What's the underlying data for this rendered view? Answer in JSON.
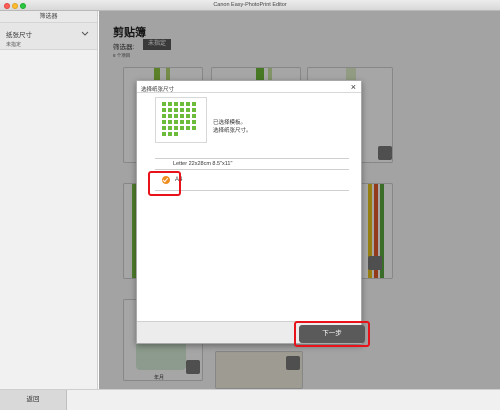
{
  "window": {
    "title": "Canon Easy-PhotoPrint Editor"
  },
  "sidebar": {
    "header": "筛选器",
    "filter": {
      "label": "纸张尺寸",
      "value": "未指定"
    }
  },
  "main": {
    "title": "剪贴簿",
    "filter_label": "筛选器:",
    "filter_badge": "未指定",
    "item_count": "8 个项目",
    "card_captions": [
      "年月"
    ]
  },
  "dialog": {
    "title": "选择纸张尺寸",
    "description_line1": "已选择模板。",
    "description_line2": "选择纸张尺寸。",
    "options": [
      {
        "label": "Letter 22x28cm 8.5\"x11\"",
        "selected": false
      },
      {
        "label": "A4",
        "selected": true
      }
    ],
    "next_button": "下一步"
  },
  "footer": {
    "back_button": "返回"
  },
  "colors": {
    "accent": "#f08c1e",
    "highlight": "#e8121a",
    "button": "#5a5a5a"
  }
}
